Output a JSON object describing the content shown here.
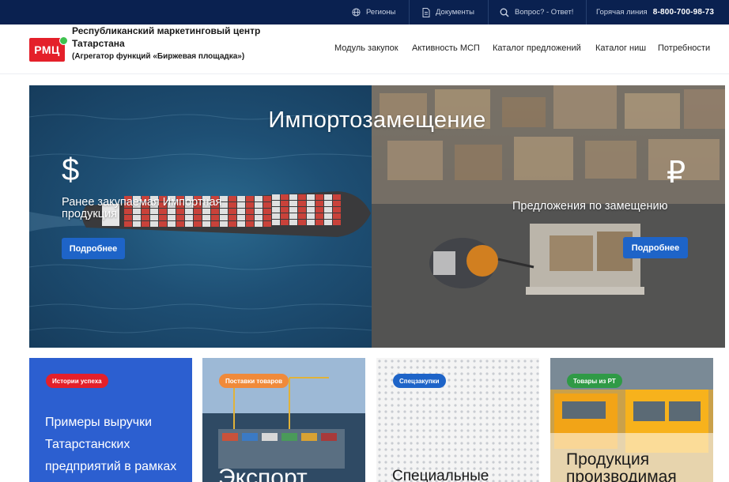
{
  "topbar": {
    "regions": "Регионы",
    "documents": "Документы",
    "faq": "Вопрос? - Ответ!",
    "hotline_label": "Горячая линия",
    "hotline_phone": "8-800-700-98-73"
  },
  "header": {
    "logo_text": "РМЦ",
    "org_name": "Республиканский маркетинговый центр Татарстана",
    "org_sub": "(Агрегатор функций «Биржевая площадка»)",
    "nav": [
      "Модуль закупок",
      "Активность МСП",
      "Каталог предложений",
      "Каталог ниш",
      "Потребности"
    ]
  },
  "hero": {
    "title": "Импортозамещение",
    "left_symbol": "$",
    "left_text": "Ранее закупаемая Импортная продукция",
    "left_button": "Подробнее",
    "right_symbol": "₽",
    "right_text": "Предложения по замещению",
    "right_button": "Подробнее"
  },
  "cards": [
    {
      "tag": "Истории успеха",
      "title": "Примеры выручки Татарстанских предприятий в рамках",
      "tag_color": "#e4202a"
    },
    {
      "tag": "Поставки товаров",
      "title": "Экспорт",
      "tag_color": "#f08a3a"
    },
    {
      "tag": "Спецзакупки",
      "title": "Специальные",
      "tag_color": "#1e64c8"
    },
    {
      "tag": "Товары из РТ",
      "title": "Продукция производимая",
      "tag_color": "#2f9a46"
    }
  ],
  "colors": {
    "topbar_bg": "#0a2150",
    "accent_blue": "#1e64c8",
    "brand_red": "#e4202a",
    "status_green": "#3fc24f"
  }
}
